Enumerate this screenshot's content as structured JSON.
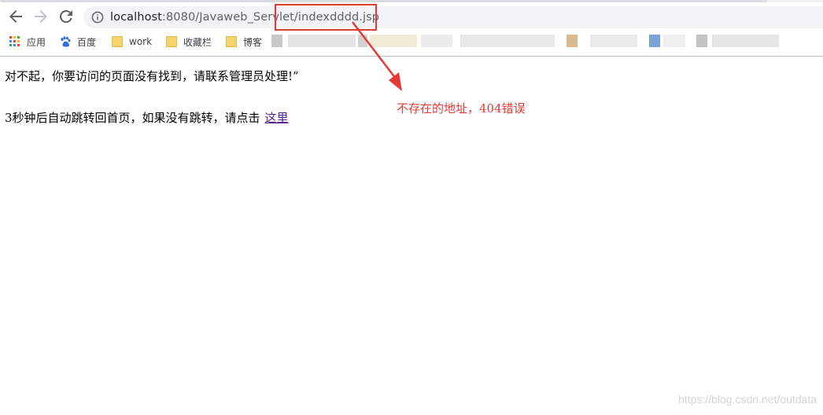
{
  "browser": {
    "url_host": "localhost",
    "url_rest": ":8080/Javaweb_Servlet/indexdddd.jsp",
    "icons": {
      "back": "arrow-left",
      "forward": "arrow-right",
      "reload": "reload",
      "info": "info-circle"
    }
  },
  "bookmarks": [
    {
      "label": "应用",
      "icon": "apps-grid-icon"
    },
    {
      "label": "百度",
      "icon": "baidu-paw-icon"
    },
    {
      "label": "work",
      "icon": "folder-icon"
    },
    {
      "label": "收藏栏",
      "icon": "folder-icon"
    },
    {
      "label": "博客",
      "icon": "folder-icon"
    }
  ],
  "page": {
    "message": "对不起，你要访问的页面没有找到，请联系管理员处理!”",
    "redirect_text": "3秒钟后自动跳转回首页，如果没有跳转，请点击",
    "redirect_link": "这里"
  },
  "annotation": {
    "text": "不存在的地址，404错误",
    "color": "#e53935"
  },
  "watermark": "https://blog.csdn.net/outdata"
}
